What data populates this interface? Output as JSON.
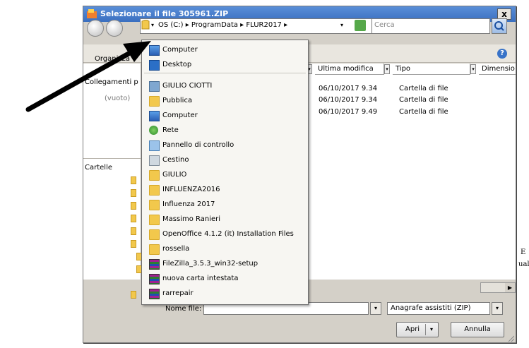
{
  "dialog": {
    "title": "Selezionare il file 305961.ZIP",
    "close_label": "x"
  },
  "address": {
    "path": "OS (C:) ▸ ProgramData ▸ FLUR2017 ▸",
    "search_placeholder": "Cerca"
  },
  "toolbar": {
    "organizza": "Organizza"
  },
  "nav": {
    "collegamenti": "Collegamenti p",
    "vuoto": "(vuoto)",
    "cartelle": "Cartelle"
  },
  "columns": {
    "ultima_modifica": "Ultima modifica",
    "tipo": "Tipo",
    "dimensione": "Dimensio"
  },
  "rows": [
    {
      "date": "06/10/2017 9.34",
      "type": "Cartella di file"
    },
    {
      "date": "06/10/2017 9.34",
      "type": "Cartella di file"
    },
    {
      "date": "06/10/2017 9.49",
      "type": "Cartella di file"
    }
  ],
  "menu": {
    "items": [
      {
        "label": "Computer",
        "icon": "computer-icon"
      },
      {
        "label": "Desktop",
        "icon": "desktop-icon"
      },
      {
        "label": "GIULIO CIOTTI",
        "icon": "user-folder-icon"
      },
      {
        "label": "Pubblica",
        "icon": "folder-icon"
      },
      {
        "label": "Computer",
        "icon": "computer-icon"
      },
      {
        "label": "Rete",
        "icon": "network-icon"
      },
      {
        "label": "Pannello di controllo",
        "icon": "control-panel-icon"
      },
      {
        "label": "Cestino",
        "icon": "recycle-bin-icon"
      },
      {
        "label": "GIULIO",
        "icon": "folder-icon"
      },
      {
        "label": "INFLUENZA2016",
        "icon": "folder-icon"
      },
      {
        "label": "Influenza 2017",
        "icon": "folder-icon"
      },
      {
        "label": "Massimo Ranieri",
        "icon": "folder-icon"
      },
      {
        "label": "OpenOffice 4.1.2 (it) Installation Files",
        "icon": "folder-icon"
      },
      {
        "label": "rossella",
        "icon": "folder-icon"
      },
      {
        "label": "FileZilla_3.5.3_win32-setup",
        "icon": "rar-archive-icon"
      },
      {
        "label": "nuova carta intestata",
        "icon": "rar-archive-icon"
      },
      {
        "label": "rarrepair",
        "icon": "rar-archive-icon"
      }
    ]
  },
  "footer": {
    "nomefile_label": "Nome file:",
    "nomefile_value": "",
    "filter_value": "Anagrafe assistiti (ZIP)",
    "apri_label": "Apri",
    "annulla_label": "Annulla"
  },
  "side_text": {
    "line1": "E",
    "line2": "ual"
  },
  "colors": {
    "titlebar": "#3a6fc0",
    "dialog_face": "#d4d0c8",
    "arrow": "#000000"
  }
}
